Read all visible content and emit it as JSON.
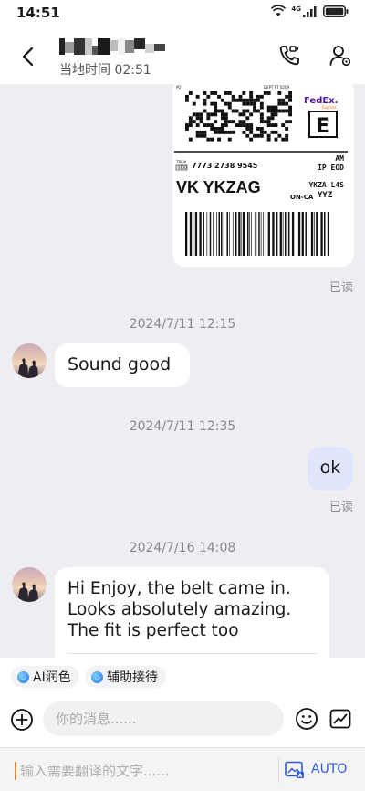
{
  "status_bar": {
    "time": "14:51",
    "network": "4G"
  },
  "header": {
    "contact_name": "",
    "local_time": "当地时间 02:51"
  },
  "shipping_label": {
    "carrier": "FedEx.",
    "carrier_sub": "Express",
    "service_letter": "E",
    "tracking_label": "TRK#",
    "tracking_number": "7773 2738 9545",
    "form_code": "0430",
    "delivery_time": "AM",
    "delivery_type": "IP EOD",
    "route_code": "VK YKZAG",
    "postal_code": "YKZA L4S",
    "destination": "ON-CA",
    "airport": "YYZ",
    "top_left": "PO",
    "top_mid": "DEPT PT 0209"
  },
  "messages": [
    {
      "type": "image",
      "read": "已读"
    },
    {
      "type": "timestamp",
      "text": "2024/7/11 12:15"
    },
    {
      "type": "incoming",
      "text": "Sound good"
    },
    {
      "type": "timestamp",
      "text": "2024/7/11 12:35"
    },
    {
      "type": "outgoing",
      "text": "ok",
      "read": "已读"
    },
    {
      "type": "timestamp",
      "text": "2024/7/16 14:08"
    },
    {
      "type": "incoming",
      "text": "Hi Enjoy, the belt came in. Looks absolutely amazing. The fit is perfect too"
    }
  ],
  "quick_actions": [
    {
      "label": "AI润色",
      "icon": "ai-polish-icon"
    },
    {
      "label": "辅助接待",
      "icon": "assist-icon"
    }
  ],
  "input": {
    "placeholder": "你的消息......"
  },
  "translate": {
    "placeholder": "输入需要翻译的文字......",
    "mode": "AUTO"
  },
  "colors": {
    "accent": "#2e5bd6",
    "chat_bg": "#eeedf2",
    "bubble_mine": "#e1e5fb",
    "cursor": "#e8842a"
  }
}
